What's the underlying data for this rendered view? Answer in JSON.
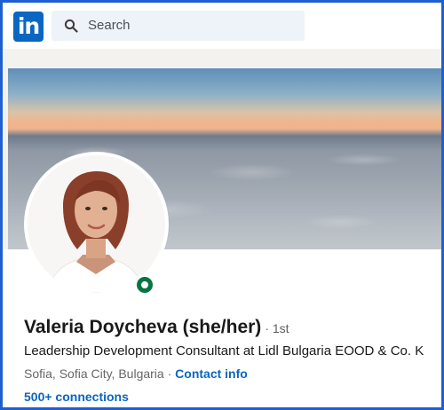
{
  "logo": {
    "text": "in"
  },
  "search": {
    "placeholder": "Search"
  },
  "profile": {
    "name": "Valeria Doycheva (she/her)",
    "degree": "· 1st",
    "headline": "Leadership Development Consultant at Lidl Bulgaria EOOD & Co. K",
    "location": "Sofia, Sofia City, Bulgaria",
    "location_sep": " · ",
    "contact_info": "Contact info",
    "connections": "500+ connections",
    "status": "online"
  },
  "colors": {
    "brand": "#0a66c2",
    "online": "#057642",
    "frame": "#1f5fcf"
  },
  "icons": {
    "search": "search-icon",
    "logo": "linkedin-logo-icon"
  }
}
